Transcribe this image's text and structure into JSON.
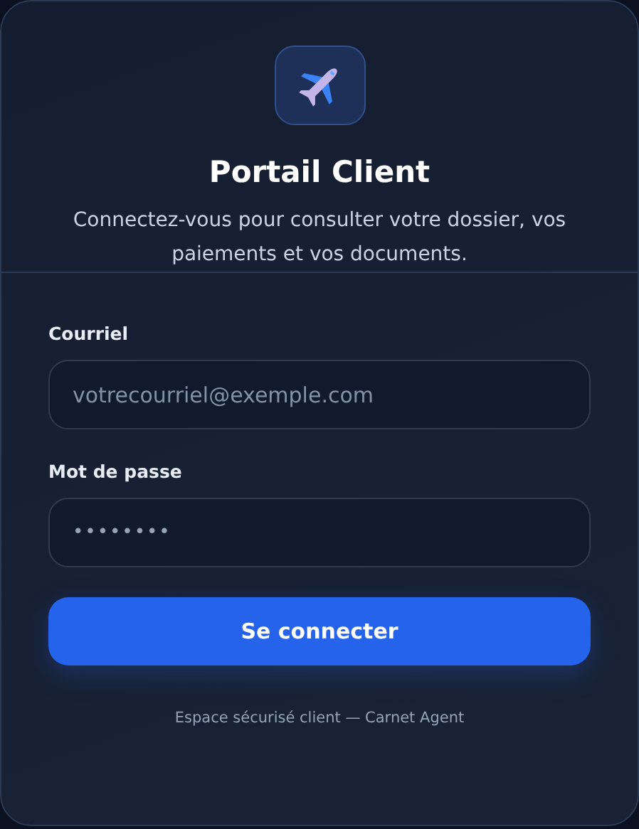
{
  "header": {
    "title": "Portail Client",
    "subtitle": "Connectez-vous pour consulter votre dossier, vos paiements et vos documents."
  },
  "form": {
    "fields": [
      {
        "label": "Courriel",
        "kind": "email",
        "placeholder": "votrecourriel@exemple.com"
      },
      {
        "label": "Mot de passe",
        "kind": "password",
        "value": "••••••••"
      }
    ],
    "submit": "Se connecter"
  },
  "footer": "Espace sécurisé client — Carnet Agent"
}
